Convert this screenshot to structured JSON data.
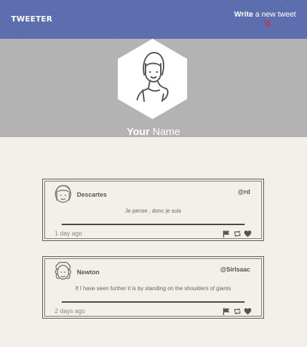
{
  "header": {
    "logo": "TWEETER",
    "write_bold": "Write",
    "write_rest": " a new tweet",
    "accent": "#c8324a",
    "bg": "#5b6db0"
  },
  "profile": {
    "name_bold": "Your",
    "name_rest": " Name"
  },
  "tweets": [
    {
      "author": "Descartes",
      "handle": "@rd",
      "text": "Je pense , donc je suis",
      "time": "1 day ago"
    },
    {
      "author": "Newton",
      "handle": "@SirIsaac",
      "text": "If I have seen further it is by standing on the shoulders of giants",
      "time": "2 days ago"
    }
  ],
  "icons": {
    "flag": "flag-icon",
    "retweet": "retweet-icon",
    "like": "heart-icon"
  }
}
